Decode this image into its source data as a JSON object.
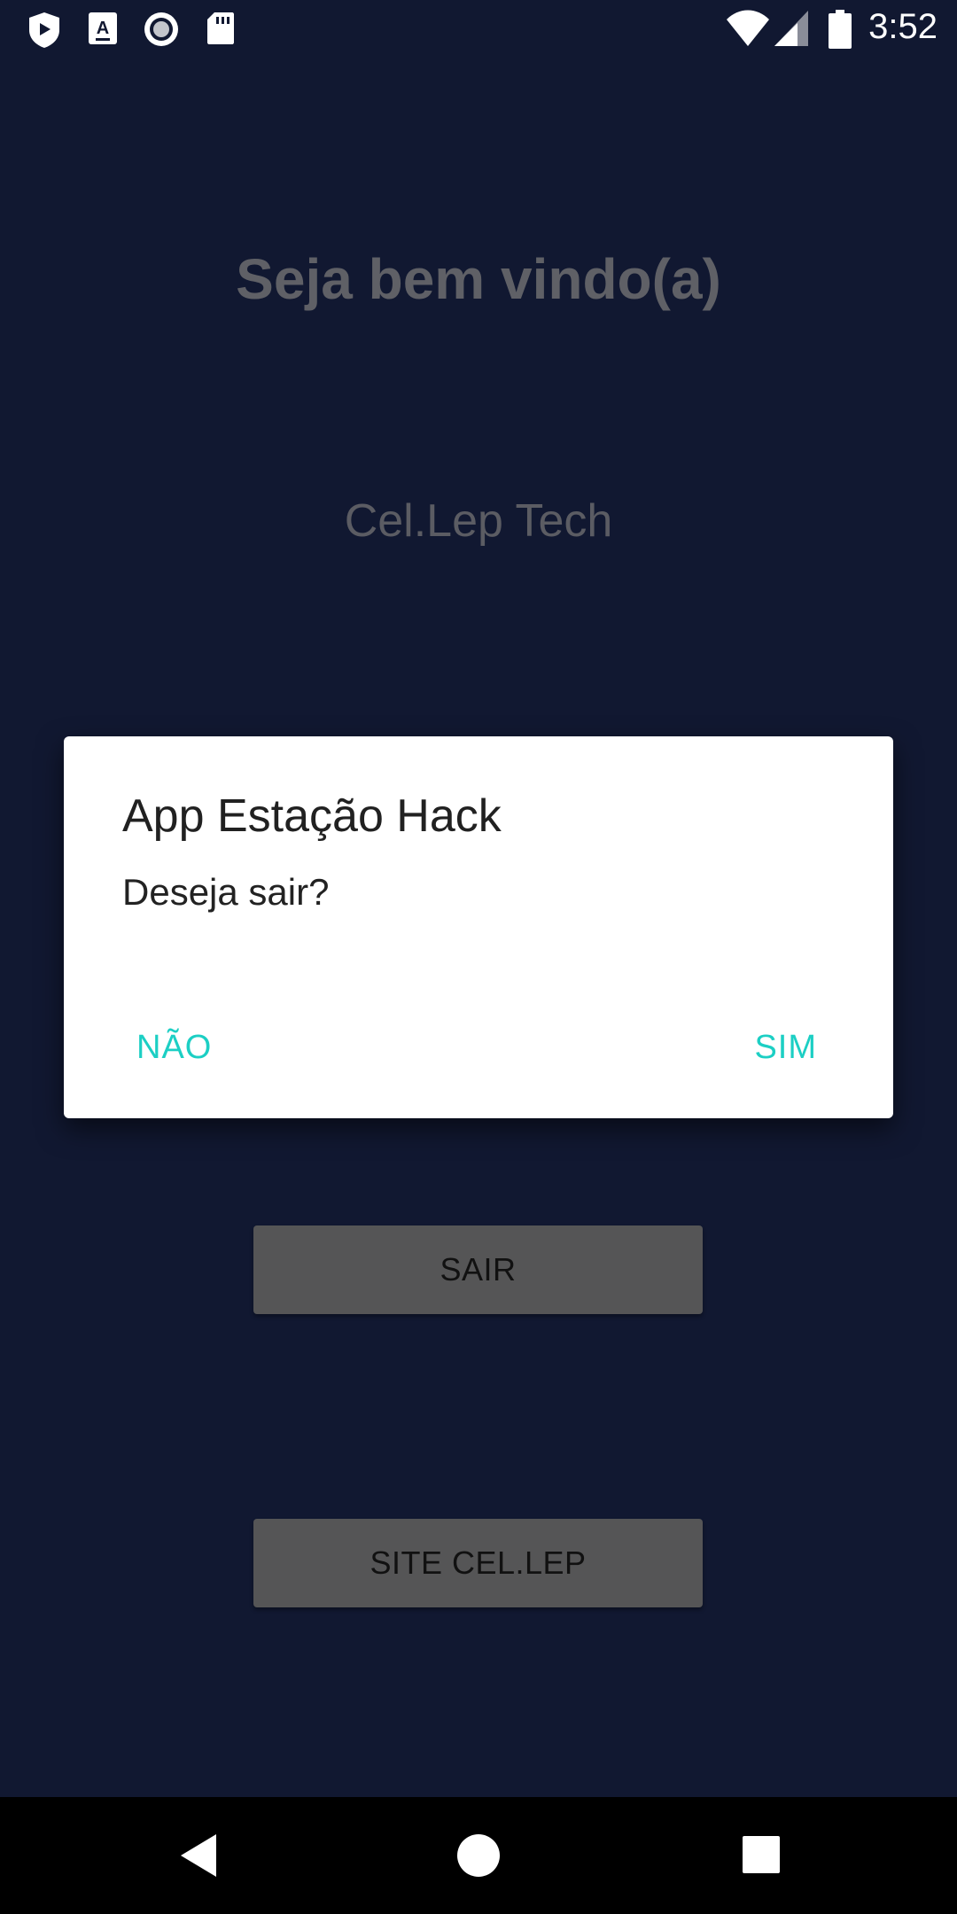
{
  "status_bar": {
    "time": "3:52",
    "icons": [
      "shield-icon",
      "a-text-icon",
      "record-icon",
      "sd-card-icon",
      "wifi-icon",
      "signal-icon",
      "battery-icon"
    ]
  },
  "main": {
    "welcome": "Seja bem vindo(a)",
    "company": "Cel.Lep Tech",
    "exit_button": "SAIR",
    "site_button": "SITE CEL.LEP"
  },
  "dialog": {
    "title": "App Estação Hack",
    "message": "Deseja sair?",
    "negative": "NÃO",
    "positive": "SIM"
  },
  "nav": {
    "icons": [
      "back-icon",
      "home-icon",
      "recents-icon"
    ]
  },
  "colors": {
    "background": "#111831",
    "accent": "#1ccfc4",
    "button": "#555556",
    "dialog": "#ffffff"
  }
}
